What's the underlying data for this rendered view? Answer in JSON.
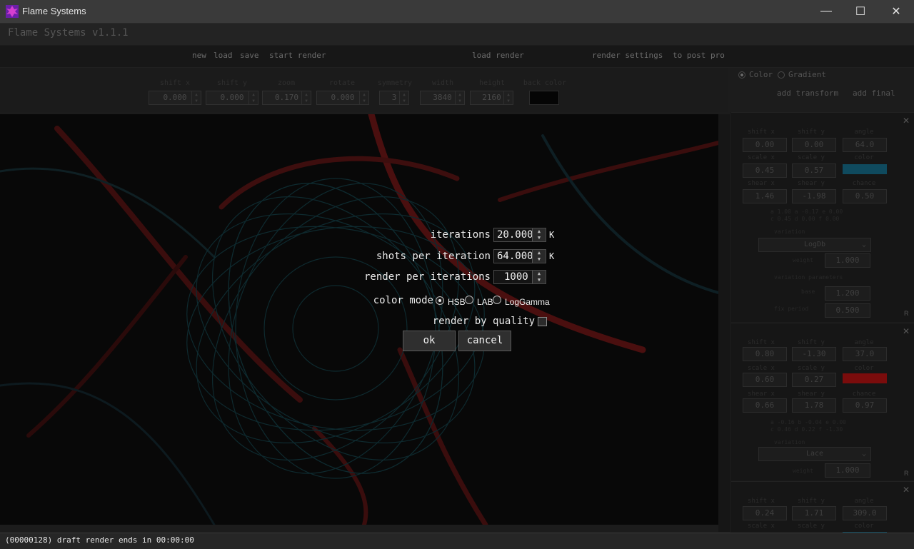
{
  "window": {
    "title": "Flame Systems",
    "minimize": "—",
    "maximize": "☐",
    "close": "✕"
  },
  "app": {
    "version_label": "Flame Systems v1.1.1"
  },
  "menu": {
    "new": "new",
    "load": "load",
    "save": "save",
    "start_render": "start render",
    "load_render": "load render",
    "render_settings": "render settings",
    "to_post_pro": "to post pro"
  },
  "params": {
    "shift_x": {
      "label": "shift x",
      "value": "0.000"
    },
    "shift_y": {
      "label": "shift y",
      "value": "0.000"
    },
    "zoom": {
      "label": "zoom",
      "value": "0.170"
    },
    "rotate": {
      "label": "rotate",
      "value": "0.000"
    },
    "symmetry": {
      "label": "symmetry",
      "value": "3"
    },
    "width": {
      "label": "width",
      "value": "3840"
    },
    "height": {
      "label": "height",
      "value": "2160"
    },
    "back_color": {
      "label": "back color",
      "color": "#050505"
    }
  },
  "right_top": {
    "color_label": "Color",
    "gradient_label": "Gradient",
    "selected": "Color",
    "add_transform": "add transform",
    "add_final": "add final"
  },
  "transforms": [
    {
      "shift_x": "0.00",
      "shift_y": "0.00",
      "angle": "64.0",
      "scale_x": "0.45",
      "scale_y": "0.57",
      "color": "#0f4a5e",
      "shear_x": "1.46",
      "shear_y": "-1.98",
      "chance": "0.50",
      "coef1": "a 1.00  a -0.17  e 0.00",
      "coef2": "c 0.45  d 0.00  f 0.00",
      "variation": "LogDb",
      "weight": "1.000",
      "base": "1.200",
      "fix_period": "0.500"
    },
    {
      "shift_x": "0.80",
      "shift_y": "-1.30",
      "angle": "37.0",
      "scale_x": "0.60",
      "scale_y": "0.27",
      "color": "#7a0c0c",
      "shear_x": "0.66",
      "shear_y": "1.78",
      "chance": "0.97",
      "coef1": "a -0.16 b -0.04 e 0.00",
      "coef2": "c 0.46  d 0.22  f -1.30",
      "variation": "Lace",
      "weight": "1.000"
    },
    {
      "shift_x": "0.24",
      "shift_y": "1.71",
      "angle": "309.0",
      "color": "#0f4a5e"
    }
  ],
  "transform_labels": {
    "shift_x": "shift x",
    "shift_y": "shift y",
    "angle": "angle",
    "scale_x": "scale x",
    "scale_y": "scale y",
    "color": "color",
    "shear_x": "shear x",
    "shear_y": "shear y",
    "chance": "chance",
    "variation": "variation",
    "weight": "weight",
    "variation_parameters": "variation parameters",
    "base": "base",
    "fix_period": "fix period",
    "close": "✕",
    "r": "R"
  },
  "dialog": {
    "iterations_label": "iterations",
    "iterations_value": "20.000",
    "iterations_unit": "K",
    "shots_label": "shots per iteration",
    "shots_value": "64.000",
    "shots_unit": "K",
    "render_per_label": "render per iterations",
    "render_per_value": "1000",
    "color_mode_label": "color mode",
    "color_mode_options": [
      "HSB",
      "LAB",
      "LogGamma"
    ],
    "color_mode_selected": "HSB",
    "render_by_quality_label": "render by quality",
    "render_by_quality_checked": false,
    "ok": "ok",
    "cancel": "cancel"
  },
  "status": {
    "text": "(00000128) draft render ends in 00:00:00"
  }
}
